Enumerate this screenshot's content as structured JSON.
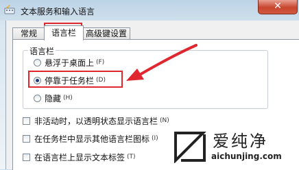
{
  "window": {
    "title": "文本服务和输入语言",
    "close_glyph": "✕"
  },
  "tabs": [
    {
      "label": "常规"
    },
    {
      "label": "语言栏"
    },
    {
      "label": "高级键设置"
    }
  ],
  "language_bar_group": {
    "label": "语言栏",
    "options": [
      {
        "label": "悬浮于桌面上",
        "hotkey": "(F)",
        "checked": false
      },
      {
        "label": "停靠于任务栏",
        "hotkey": "(D)",
        "checked": true
      },
      {
        "label": "隐藏",
        "hotkey": "(H)",
        "checked": false
      }
    ]
  },
  "checkboxes": [
    {
      "label": "非活动时，以透明状态显示语言栏",
      "hotkey": "(N)",
      "checked": false
    },
    {
      "label": "在任务栏中显示其他语言栏图标",
      "hotkey": "(I)",
      "checked": false
    },
    {
      "label": "在语言栏上显示文本标签",
      "hotkey": "(T)",
      "checked": false
    }
  ],
  "watermark": {
    "text": "爱纯净",
    "url": "aichunjing.com"
  },
  "colors": {
    "highlight": "#e0262f",
    "arrow": "#e0262f"
  }
}
